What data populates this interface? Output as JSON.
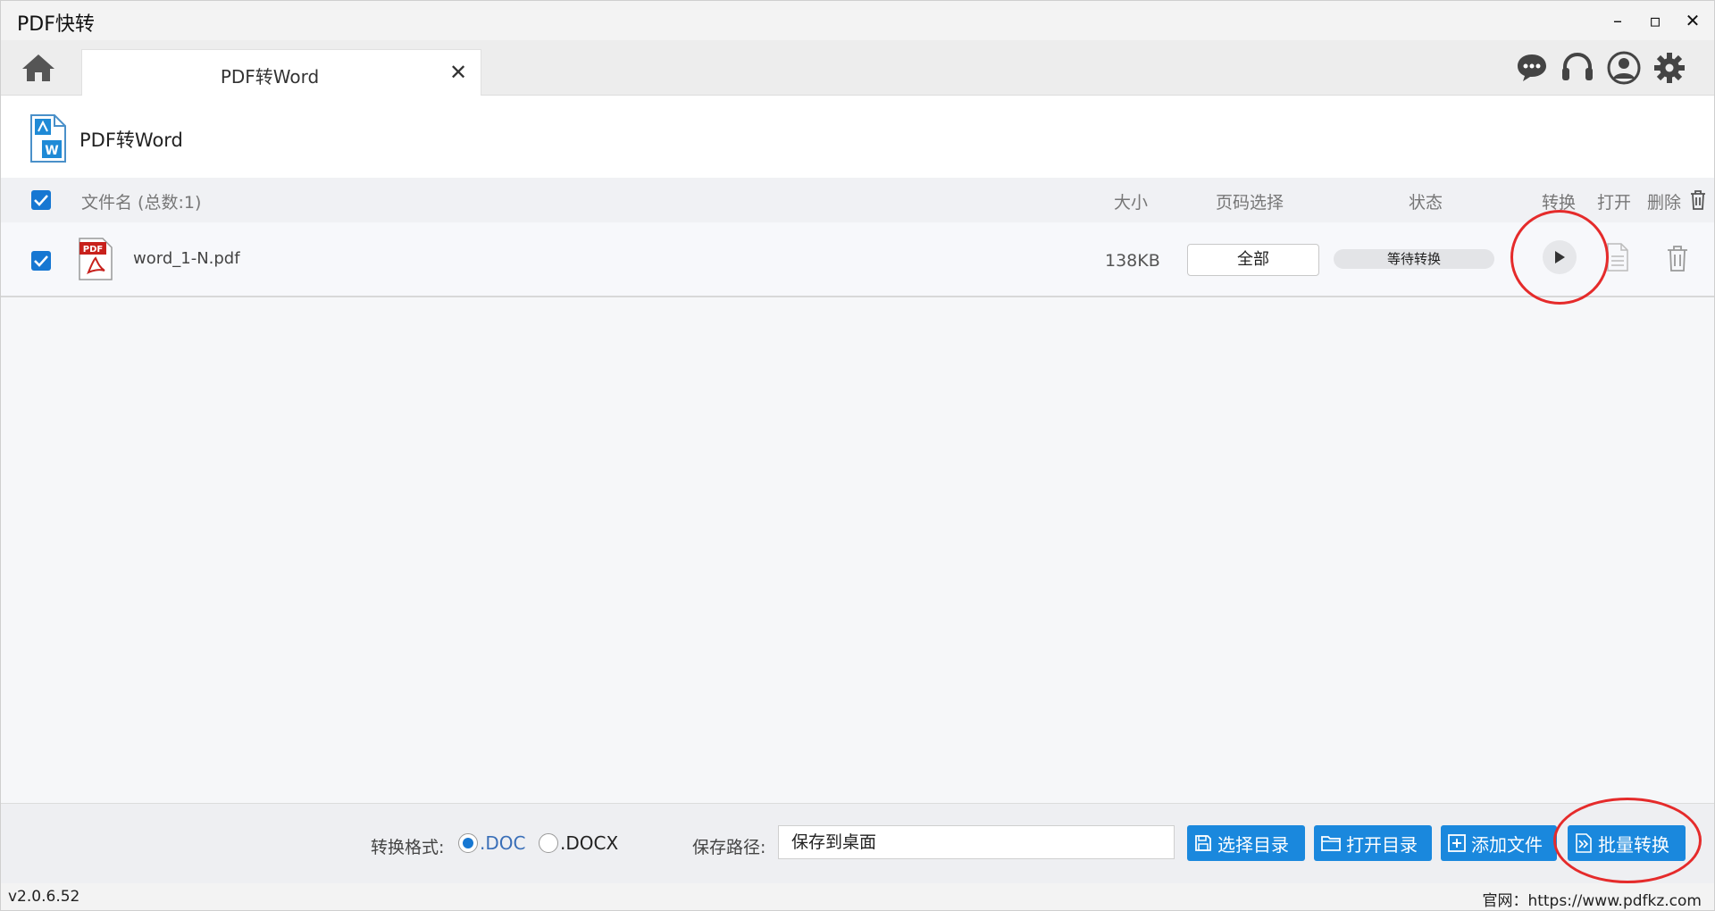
{
  "app": {
    "title": "PDF快转"
  },
  "window_controls": {
    "minimize": "–",
    "maximize": "▫",
    "close": "✕"
  },
  "tab": {
    "label": "PDF转Word",
    "close": "✕"
  },
  "module": {
    "title": "PDF转Word"
  },
  "table": {
    "headers": {
      "name": "文件名 (总数:1)",
      "size": "大小",
      "page": "页码选择",
      "status": "状态",
      "convert": "转换",
      "open": "打开",
      "delete": "删除"
    },
    "rows": [
      {
        "name": "word_1-N.pdf",
        "size": "138KB",
        "page": "全部",
        "status": "等待转换",
        "checked": true
      }
    ]
  },
  "bottom": {
    "format_label": "转换格式:",
    "formats": [
      ".DOC",
      ".DOCX"
    ],
    "selected_format": ".DOC",
    "path_label": "保存路径:",
    "path_value": "保存到桌面",
    "buttons": {
      "choose_dir": "选择目录",
      "open_dir": "打开目录",
      "add_file": "添加文件",
      "batch": "批量转换"
    }
  },
  "status_bar": {
    "version": "v2.0.6.52",
    "site": "官网：https://www.pdfkz.com"
  },
  "colors": {
    "accent": "#1a88dd",
    "checkbox": "#1677d2",
    "highlight": "#e52b2b"
  }
}
